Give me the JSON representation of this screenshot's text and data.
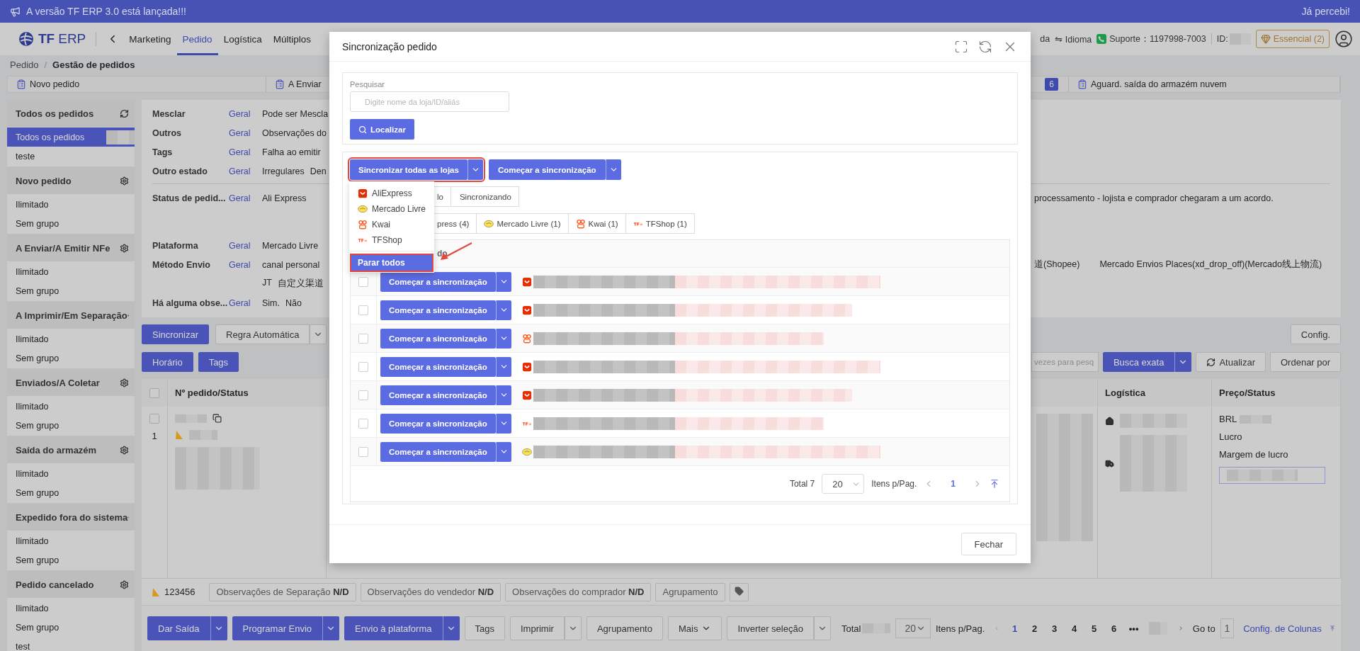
{
  "announcement": {
    "text": "A versão TF ERP 3.0 está lançada!!!",
    "dismiss": "Já percebi!"
  },
  "nav": {
    "logo_mark": "TF",
    "logo_name": "ERP",
    "menu": [
      {
        "label": "Marketing",
        "selected": false
      },
      {
        "label": "Pedido",
        "selected": true
      },
      {
        "label": "Logística",
        "selected": false
      },
      {
        "label": "Múltiplos",
        "selected": false
      }
    ],
    "partial": "da",
    "language": "⇋ Idioma",
    "support": "Suporte：1197998-7003",
    "id_label": "ID:",
    "plan": "Essencial (2)"
  },
  "breadcrumb": {
    "items": [
      "Pedido",
      "Gestão de pedidos"
    ],
    "separator": "/"
  },
  "steps": [
    {
      "label": "Novo pedido"
    },
    {
      "label": "A Enviar",
      "count": "6"
    },
    {
      "label": "Aguard. saída do armazém nuvem"
    }
  ],
  "sidebar": [
    {
      "title": "Todos os pedidos",
      "kind": "refresh",
      "items": [
        {
          "label": "Todos os pedidos",
          "selected": true
        },
        {
          "label": "teste",
          "selected": false
        }
      ]
    },
    {
      "title": "Novo pedido",
      "kind": "settings",
      "items": [
        {
          "label": "Ilimitado",
          "selected": false
        },
        {
          "label": "Sem grupo",
          "selected": false
        }
      ]
    },
    {
      "title": "A Enviar/A Emitir NFe",
      "kind": "settings",
      "items": [
        {
          "label": "Ilimitado",
          "selected": false
        },
        {
          "label": "Sem grupo",
          "selected": false
        }
      ]
    },
    {
      "title": "A Imprimir/Em Separação",
      "kind": "settings",
      "items": [
        {
          "label": "Ilimitado",
          "selected": false
        },
        {
          "label": "Sem grupo",
          "selected": false
        }
      ]
    },
    {
      "title": "Enviados/A Coletar",
      "kind": "settings",
      "items": [
        {
          "label": "Ilimitado",
          "selected": false
        },
        {
          "label": "Sem grupo",
          "selected": false
        }
      ]
    },
    {
      "title": "Saída do armazém",
      "kind": "settings",
      "items": [
        {
          "label": "Ilimitado",
          "selected": false
        },
        {
          "label": "Sem grupo",
          "selected": false
        }
      ]
    },
    {
      "title": "Expedido fora do sistema",
      "kind": "settings",
      "items": [
        {
          "label": "Ilimitado",
          "selected": false
        },
        {
          "label": "Sem grupo",
          "selected": false
        }
      ]
    },
    {
      "title": "Pedido cancelado",
      "kind": "settings",
      "items": [
        {
          "label": "Ilimitado",
          "selected": false
        },
        {
          "label": "Sem grupo",
          "selected": false
        },
        {
          "label": "test",
          "selected": false
        }
      ]
    }
  ],
  "filters": [
    {
      "label": "Mesclar",
      "scope": "Geral",
      "values": [
        "Pode ser Mescla"
      ]
    },
    {
      "label": "Outros",
      "scope": "Geral",
      "values": [
        "Observações do"
      ]
    },
    {
      "label": "Tags",
      "scope": "Geral",
      "values": [
        "Falha ao emitir"
      ]
    },
    {
      "label": "Outro estado",
      "scope": "Geral",
      "values": [
        "Irregulares",
        "Den"
      ]
    },
    {
      "label": "Status de pedid...",
      "scope": "Geral",
      "values": [
        "Ali Express"
      ],
      "right": [
        "processamento - lojista e comprador chegaram a um acordo."
      ],
      "kind": "multiline",
      "divider_before": true
    },
    {
      "label": "Plataforma",
      "scope": "Geral",
      "values": [
        "Mercado Livre"
      ]
    },
    {
      "label": "Método Envio",
      "scope": "Geral",
      "values": [
        "canal personal"
      ],
      "right": [
        "道(Shopee)",
        "Mercado Envios Places(xd_drop_off)(Mercado线上物流)"
      ]
    },
    {
      "values": [
        "JT",
        "自定义渠道"
      ]
    },
    {
      "label": "Há alguma obse...",
      "scope": "Geral",
      "values": [
        "Sim.",
        "Não"
      ]
    }
  ],
  "toolbar": {
    "row1": [
      {
        "label": "Sincronizar",
        "kind": "primary"
      },
      {
        "label": "Regra Automática",
        "kind": "split"
      }
    ],
    "config": "Config.",
    "row2": [
      {
        "label": "Horário",
        "kind": "primary"
      },
      {
        "label": "Tags",
        "kind": "primary"
      }
    ],
    "search_placeholder": "vezes para pesq",
    "search_mode": "Busca exata",
    "refresh": "Atualizar",
    "sort": "Ordenar por"
  },
  "orders": {
    "columns": [
      "Nº pedido/Status",
      "Logística",
      "Preço/Status"
    ],
    "row": {
      "checked": false,
      "index": "1",
      "price_labels": [
        "BRL",
        "Lucro",
        "Margem de lucro"
      ]
    },
    "footer": {
      "order_no": "123456",
      "notes": [
        "Observações de Separação **N/D**",
        "Observações do vendedor **N/D**",
        "Observações do comprador **N/D**"
      ],
      "group": "Agrupamento"
    }
  },
  "bottom_bar": {
    "buttons": [
      {
        "label": "Dar Saída",
        "kind": "primary-split"
      },
      {
        "label": "Programar Envio",
        "kind": "primary-split"
      },
      {
        "label": "Envio à plataforma",
        "kind": "primary-split"
      },
      {
        "label": "Tags",
        "kind": "plain"
      },
      {
        "label": "Imprimir",
        "kind": "split"
      },
      {
        "label": "Agrupamento",
        "kind": "plain"
      },
      {
        "label": "Mais",
        "kind": "menu"
      },
      {
        "label": "Inverter seleção",
        "kind": "split"
      }
    ],
    "total_label": "Total",
    "page_size": "20",
    "per_page": "Itens p/Pag.",
    "pages": [
      {
        "label": "1",
        "selected": true
      },
      {
        "label": "2",
        "selected": false
      },
      {
        "label": "3",
        "selected": false
      },
      {
        "label": "4",
        "selected": false
      },
      {
        "label": "5",
        "selected": false
      },
      {
        "label": "6",
        "selected": false
      }
    ],
    "ellipsis": "•••",
    "goto_label": "Go to",
    "goto_value": "1",
    "columns_link": "Config. de Colunas"
  },
  "modal": {
    "title": "Sincronização pedido",
    "search_label": "Pesquisar",
    "search_placeholder": "Digite nome da loja/ID/aliás",
    "search_button": "Localizar",
    "sync_all": {
      "label": "Sincronizar todas as lojas",
      "highlighted": true
    },
    "start_sync": "Começar a sincronização",
    "status_tabs": [
      {
        "label": "lo",
        "selected": false
      },
      {
        "label": "Sincronizando",
        "selected": false
      }
    ],
    "platform_tabs": [
      {
        "label": "press (4)"
      },
      {
        "label": "Mercado Livre (1)",
        "kind": "mercado"
      },
      {
        "label": "Kwai (1)",
        "kind": "kwai"
      },
      {
        "label": "TFShop (1)",
        "kind": "tfshop"
      }
    ],
    "table_header": "do",
    "rows": [
      {
        "kind": "aliexpress",
        "checked": false,
        "action": "Começar a sincronização"
      },
      {
        "kind": "aliexpress",
        "checked": false,
        "action": "Começar a sincronização"
      },
      {
        "kind": "kwai",
        "checked": false,
        "action": "Começar a sincronização"
      },
      {
        "kind": "aliexpress",
        "checked": false,
        "action": "Começar a sincronização"
      },
      {
        "kind": "aliexpress",
        "checked": false,
        "action": "Começar a sincronização"
      },
      {
        "kind": "tfshop",
        "checked": false,
        "action": "Começar a sincronização"
      },
      {
        "kind": "mercado",
        "checked": false,
        "action": "Começar a sincronização"
      }
    ],
    "pagination": {
      "total": "Total 7",
      "page_size": "20",
      "per_page": "Itens p/Pag.",
      "page": "1"
    },
    "dropdown": {
      "items": [
        {
          "label": "AliExpress",
          "kind": "aliexpress"
        },
        {
          "label": "Mercado Livre",
          "kind": "mercado"
        },
        {
          "label": "Kwai",
          "kind": "kwai"
        },
        {
          "label": "TFShop",
          "kind": "tfshop"
        }
      ],
      "stop": {
        "label": "Parar todos",
        "highlighted": true
      }
    },
    "close": "Fechar"
  }
}
